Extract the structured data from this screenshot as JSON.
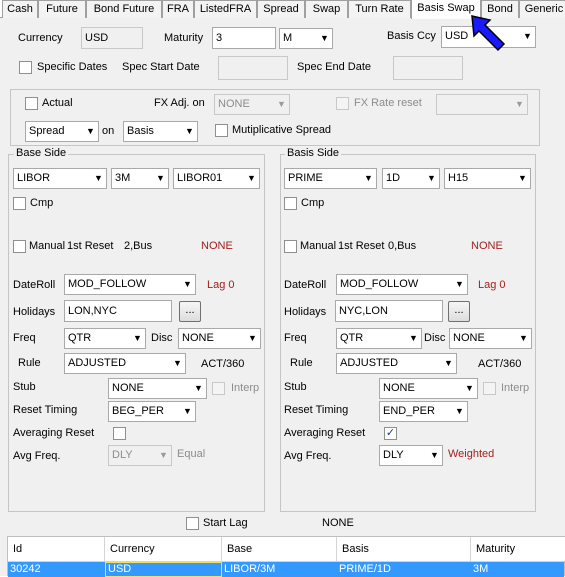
{
  "tabs": [
    "Cash",
    "Future",
    "Bond Future",
    "FRA",
    "ListedFRA",
    "Spread",
    "Swap",
    "Turn Rate",
    "Basis Swap",
    "Bond",
    "Generic"
  ],
  "active_tab": "Basis Swap",
  "top": {
    "currency_label": "Currency",
    "currency": "USD",
    "maturity_label": "Maturity",
    "maturity": "3",
    "maturity_unit": "M",
    "basis_ccy_label": "Basis Ccy",
    "basis_ccy": "USD",
    "specific_dates_label": "Specific Dates",
    "spec_start_label": "Spec Start Date",
    "spec_end_label": "Spec End Date"
  },
  "options": {
    "actual_label": "Actual",
    "fx_adj_label": "FX Adj. on",
    "fx_adj": "NONE",
    "fx_rate_reset_label": "FX Rate reset",
    "spread_combo": "Spread",
    "on_label": "on",
    "basis_combo": "Basis",
    "multiplicative_label": "Mutiplicative Spread"
  },
  "base": {
    "title": "Base Side",
    "index": "LIBOR",
    "tenor": "3M",
    "curve": "LIBOR01",
    "cmp_label": "Cmp",
    "manual_label": "Manual",
    "first_reset_label": "1st Reset",
    "first_reset": "2,Bus",
    "manual_status": "NONE",
    "dateroll_label": "DateRoll",
    "dateroll": "MOD_FOLLOW",
    "lag": "Lag 0",
    "holidays_label": "Holidays",
    "holidays": "LON,NYC",
    "browse": "...",
    "freq_label": "Freq",
    "freq": "QTR",
    "disc_label": "Disc",
    "disc": "NONE",
    "rule_label": "Rule",
    "rule": "ADJUSTED",
    "daycount": "ACT/360",
    "stub_label": "Stub",
    "stub": "NONE",
    "interp_label": "Interp",
    "reset_timing_label": "Reset Timing",
    "reset_timing": "BEG_PER",
    "averaging_reset_label": "Averaging Reset",
    "averaging_reset_checked": false,
    "avg_freq_label": "Avg Freq.",
    "avg_freq": "DLY",
    "avg_method": "Equal"
  },
  "basis": {
    "title": "Basis Side",
    "index": "PRIME",
    "tenor": "1D",
    "curve": "H15",
    "cmp_label": "Cmp",
    "manual_label": "Manual",
    "first_reset_label": "1st Reset",
    "first_reset": "0,Bus",
    "manual_status": "NONE",
    "dateroll_label": "DateRoll",
    "dateroll": "MOD_FOLLOW",
    "lag": "Lag 0",
    "holidays_label": "Holidays",
    "holidays": "NYC,LON",
    "browse": "...",
    "freq_label": "Freq",
    "freq": "QTR",
    "disc_label": "Disc",
    "disc": "NONE",
    "rule_label": "Rule",
    "rule": "ADJUSTED",
    "daycount": "ACT/360",
    "stub_label": "Stub",
    "stub": "NONE",
    "interp_label": "Interp",
    "reset_timing_label": "Reset Timing",
    "reset_timing": "END_PER",
    "averaging_reset_label": "Averaging Reset",
    "averaging_reset_checked": true,
    "avg_freq_label": "Avg Freq.",
    "avg_freq": "DLY",
    "avg_method": "Weighted"
  },
  "start_lag_label": "Start Lag",
  "start_lag_value": "NONE",
  "grid": {
    "headers": [
      "Id",
      "Currency",
      "Base",
      "Basis",
      "Maturity"
    ],
    "row": [
      "30242",
      "USD",
      "LIBOR/3M",
      "PRIME/1D",
      "3M"
    ]
  },
  "check_glyph": "✓",
  "arrow_glyph": "▼",
  "colors": {
    "selection": "#3399ff",
    "red_text": "#a3201f",
    "pointer": "#1a1aff"
  }
}
